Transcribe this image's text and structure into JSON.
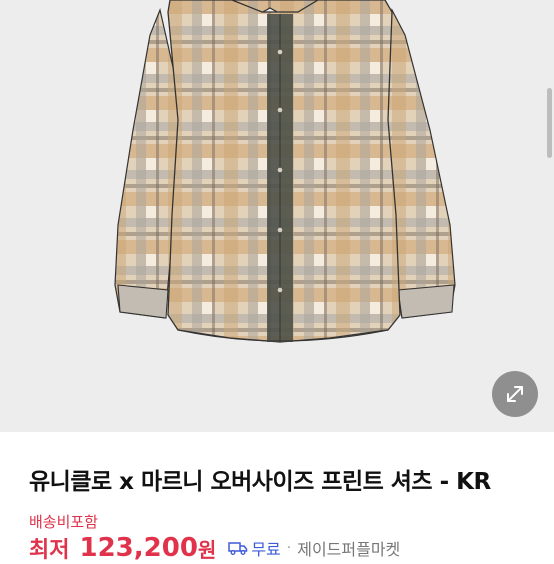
{
  "product": {
    "title": "유니클로 x 마르니 오버사이즈 프린트 셔츠 - KR",
    "shipping_note": "배송비포함",
    "price_label": "최저",
    "price_value": "123,200",
    "price_unit": "원",
    "delivery_label": "무료",
    "seller_separator": "·",
    "seller_name": "제이드퍼플마켓"
  },
  "colors": {
    "accent_red": "#e0334b",
    "delivery_blue": "#3d5bd9",
    "image_background": "#ededed",
    "shirt_beige": "#d9b98f",
    "shirt_gray": "#b9b4ad",
    "placket_dark": "#4a4e48"
  },
  "icons": {
    "expand": "expand-diagonal-arrows-icon",
    "delivery": "truck-icon"
  }
}
